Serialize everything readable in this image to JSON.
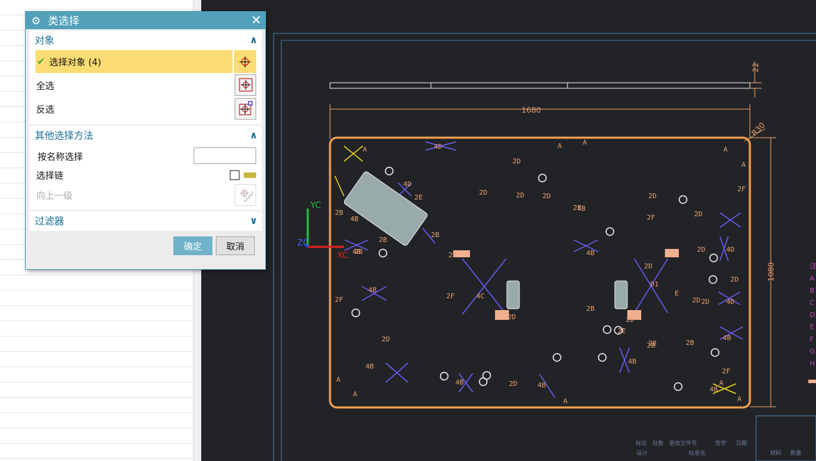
{
  "dialog": {
    "title": "类选择",
    "close_icon": "close-icon",
    "sections": {
      "objects": {
        "title": "对象",
        "select_objects": "选择对象 (4)",
        "select_all": "全选",
        "invert": "反选"
      },
      "other": {
        "title": "其他选择方法",
        "by_name": "按名称选择",
        "by_name_value": "",
        "chain": "选择链",
        "chain_checked": false,
        "up_level": "向上一级"
      },
      "filter": {
        "title": "过滤器"
      }
    },
    "ok": "确定",
    "cancel": "取消"
  },
  "viewport": {
    "axes": {
      "y": "YC",
      "z": "ZC",
      "x": "XC"
    },
    "dims": {
      "width": "1680",
      "height": "1080",
      "top": "22",
      "radius": "R30"
    },
    "labels": [
      "A",
      "4D",
      "2D",
      "A",
      "A",
      "A",
      "A",
      "4D",
      "2E",
      "2D",
      "2D",
      "2D",
      "2E",
      "2D",
      "2F",
      "2D",
      "2F",
      "2B",
      "4B",
      "2B",
      "2B",
      "4B",
      "2D",
      "2D",
      "4D",
      "2D",
      "2B",
      "4C",
      "2D",
      "2F",
      "4B",
      "2D",
      "D1",
      "E",
      "4D",
      "2D",
      "2F",
      "2B",
      "2E",
      "2B",
      "2B",
      "2D",
      "2D",
      "4B",
      "4B",
      "4B",
      "4B",
      "2D",
      "4B",
      "A",
      "A",
      "A",
      "2F",
      "A",
      "A",
      "4B",
      "2D",
      "4B",
      "2B",
      "4B"
    ],
    "notes": [
      "注",
      "A",
      "B",
      "C",
      "D",
      "E",
      "F",
      "G",
      "H"
    ],
    "titleblock": [
      "标记",
      "处数",
      "更改文件号",
      "签字",
      "日期",
      "设计",
      "标准化",
      "材料",
      "数量"
    ],
    "colors": {
      "outline": "#f0a050",
      "blue": "#6a5af0",
      "yellow": "#e0d020",
      "magenta": "#c040c0",
      "sheet": "#4a78a8",
      "white": "#e8e8e8"
    }
  }
}
